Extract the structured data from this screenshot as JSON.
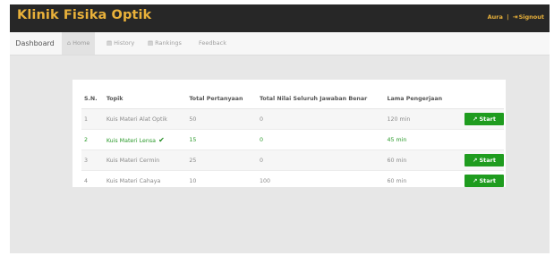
{
  "app": {
    "title": "Klinik Fisika Optik"
  },
  "user": {
    "name": "Aura",
    "separator": "|",
    "signout_label": "Signout"
  },
  "nav": {
    "dashboard": "Dashboard",
    "items": [
      {
        "label": "Home",
        "icon": "home-icon",
        "active": true
      },
      {
        "label": "History",
        "icon": "history-icon",
        "active": false
      },
      {
        "label": "Rankings",
        "icon": "rankings-icon",
        "active": false
      },
      {
        "label": "Feedback",
        "icon": "",
        "active": false
      }
    ]
  },
  "table": {
    "headers": [
      "S.N.",
      "Topik",
      "Total Pertanyaan",
      "Total Nilai Seluruh Jawaban Benar",
      "Lama Pengerjaan",
      ""
    ],
    "start_label": "Start",
    "rows": [
      {
        "sn": "1",
        "topic": "Kuis Materi Alat Optik",
        "total": "50",
        "score": "0",
        "duration": "120 min",
        "done": false
      },
      {
        "sn": "2",
        "topic": "Kuis Materi Lensa",
        "total": "15",
        "score": "0",
        "duration": "45 min",
        "done": true
      },
      {
        "sn": "3",
        "topic": "Kuis Materi Cermin",
        "total": "25",
        "score": "0",
        "duration": "60 min",
        "done": false
      },
      {
        "sn": "4",
        "topic": "Kuis Materi Cahaya",
        "total": "10",
        "score": "100",
        "duration": "60 min",
        "done": false
      }
    ]
  },
  "colors": {
    "brand": "#e9b13a",
    "topbar": "#272727",
    "start_button": "#1f9c1f",
    "done_text": "#2a9a2a"
  }
}
